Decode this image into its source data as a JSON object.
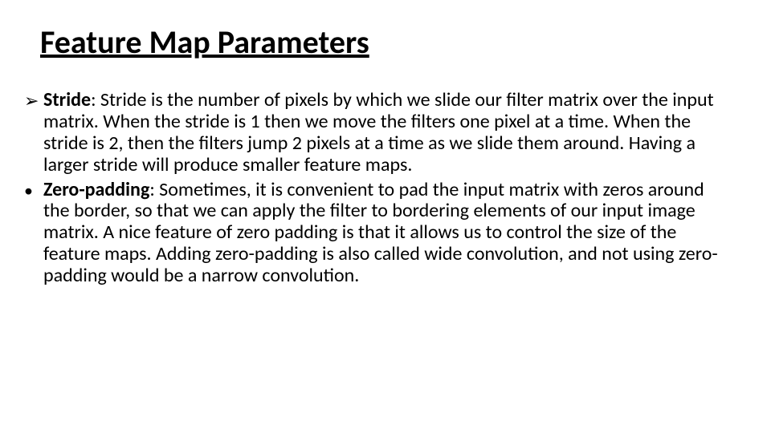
{
  "title": "Feature Map Parameters",
  "items": [
    {
      "bullet": "➢",
      "term": "Stride",
      "text": ": Stride is the number of pixels by which we slide our filter matrix over the input matrix. When the stride is 1 then we move the filters one pixel at a time. When the stride is 2, then the filters jump 2 pixels at a time as we slide them around. Having a larger stride will produce smaller feature maps."
    },
    {
      "bullet": "•",
      "term": "Zero-padding",
      "text": ": Sometimes, it is convenient to pad the input matrix with zeros around the border, so that we can apply the filter to bordering elements of our input image matrix. A nice feature of zero padding is that it allows us to control the size of the feature maps. Adding zero-padding is also called wide convolution, and not using zero-padding would be a narrow convolution."
    }
  ]
}
